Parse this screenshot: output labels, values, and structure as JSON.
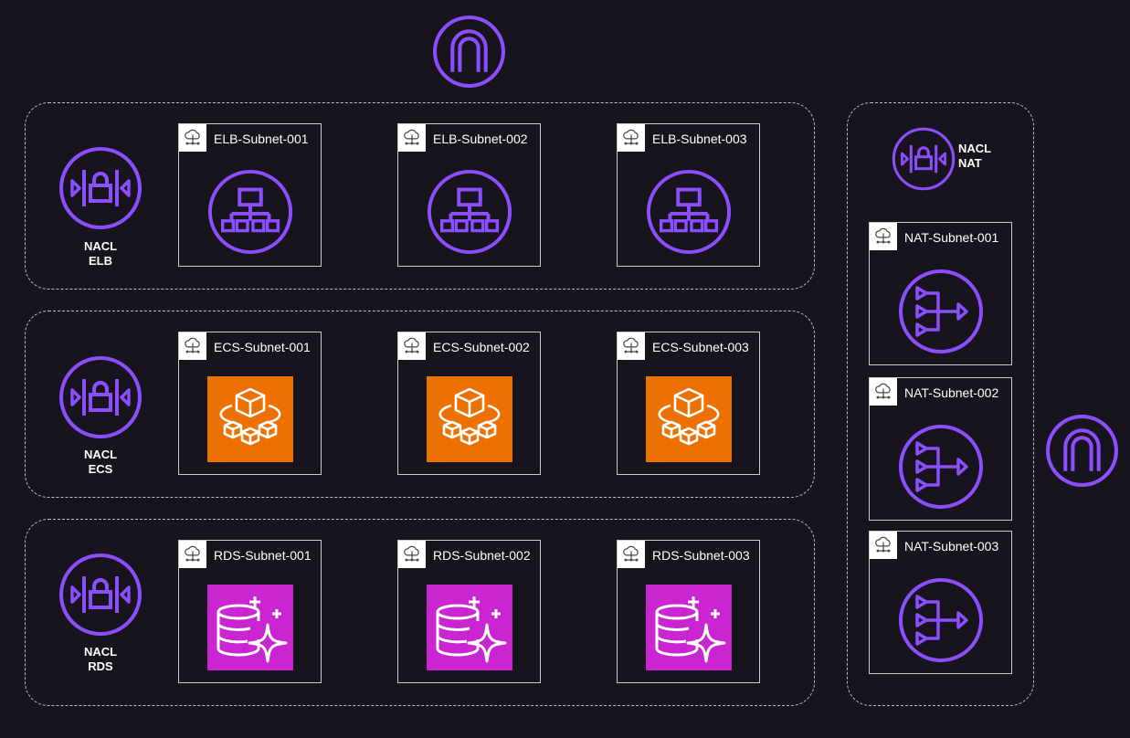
{
  "colors": {
    "background": "#18141d",
    "network_purple": "#8c4fff",
    "ecs_orange": "#ed7100",
    "rds_magenta": "#c925d1",
    "border": "#c9c9c9",
    "text": "#ffffff"
  },
  "icons": {
    "gateway": "internet-gateway-icon",
    "nacl": "network-acl-icon",
    "subnet": "vpc-subnet-cloud-icon",
    "elb": "load-balancer-icon",
    "ecs": "ecs-fargate-icon",
    "rds": "rds-database-icon",
    "nat": "nat-gateway-icon"
  },
  "nacl_elb": {
    "line1": "NACL",
    "line2": "ELB"
  },
  "nacl_ecs": {
    "line1": "NACL",
    "line2": "ECS"
  },
  "nacl_rds": {
    "line1": "NACL",
    "line2": "RDS"
  },
  "nacl_nat": {
    "line1": "NACL",
    "line2": "NAT"
  },
  "subnets": {
    "elb": [
      "ELB-Subnet-001",
      "ELB-Subnet-002",
      "ELB-Subnet-003"
    ],
    "ecs": [
      "ECS-Subnet-001",
      "ECS-Subnet-002",
      "ECS-Subnet-003"
    ],
    "rds": [
      "RDS-Subnet-001",
      "RDS-Subnet-002",
      "RDS-Subnet-003"
    ],
    "nat": [
      "NAT-Subnet-001",
      "NAT-Subnet-002",
      "NAT-Subnet-003"
    ]
  }
}
